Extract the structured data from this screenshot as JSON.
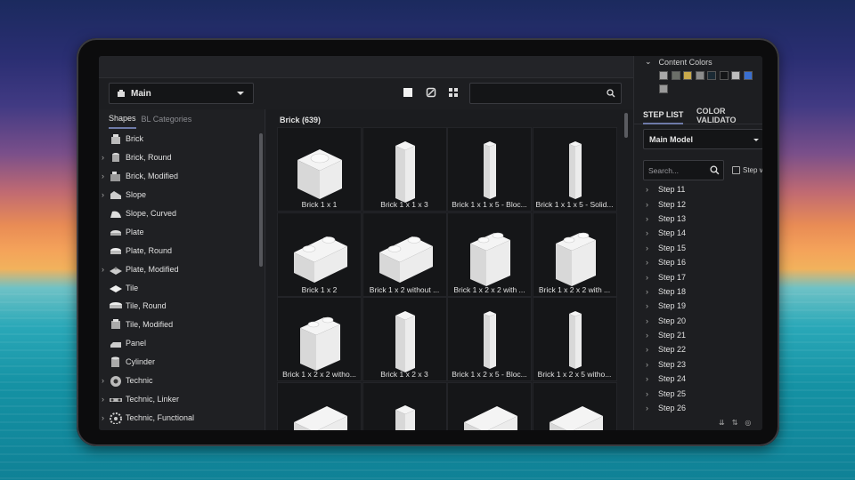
{
  "toolbar": {
    "model_dropdown": "Main",
    "search_placeholder": ""
  },
  "left_tabs": [
    {
      "label": "Shapes",
      "active": true
    },
    {
      "label": "BL Categories",
      "active": false
    }
  ],
  "categories": [
    {
      "label": "Brick",
      "expandable": false,
      "icon": "brick-icon"
    },
    {
      "label": "Brick, Round",
      "expandable": true,
      "icon": "round-brick-icon"
    },
    {
      "label": "Brick, Modified",
      "expandable": true,
      "icon": "modified-brick-icon"
    },
    {
      "label": "Slope",
      "expandable": true,
      "icon": "slope-icon"
    },
    {
      "label": "Slope, Curved",
      "expandable": false,
      "icon": "curved-slope-icon"
    },
    {
      "label": "Plate",
      "expandable": false,
      "icon": "plate-icon"
    },
    {
      "label": "Plate, Round",
      "expandable": false,
      "icon": "round-plate-icon"
    },
    {
      "label": "Plate, Modified",
      "expandable": true,
      "icon": "modified-plate-icon"
    },
    {
      "label": "Tile",
      "expandable": false,
      "icon": "tile-icon"
    },
    {
      "label": "Tile, Round",
      "expandable": false,
      "icon": "round-tile-icon"
    },
    {
      "label": "Tile, Modified",
      "expandable": false,
      "icon": "modified-tile-icon"
    },
    {
      "label": "Panel",
      "expandable": false,
      "icon": "panel-icon"
    },
    {
      "label": "Cylinder",
      "expandable": false,
      "icon": "cylinder-icon"
    },
    {
      "label": "Technic",
      "expandable": true,
      "icon": "technic-icon"
    },
    {
      "label": "Technic, Linker",
      "expandable": true,
      "icon": "technic-linker-icon"
    },
    {
      "label": "Technic, Functional",
      "expandable": true,
      "icon": "technic-functional-icon"
    }
  ],
  "grid": {
    "title": "Brick (639)",
    "parts": [
      {
        "label": "Brick 1 x 1",
        "shape": "cube"
      },
      {
        "label": "Brick 1 x 1 x 3",
        "shape": "tall"
      },
      {
        "label": "Brick 1 x 1 x 5 - Bloc...",
        "shape": "tall-thin"
      },
      {
        "label": "Brick 1 x 1 x 5 - Solid...",
        "shape": "tall-thin"
      },
      {
        "label": "Brick 1 x 2",
        "shape": "wide"
      },
      {
        "label": "Brick 1 x 2 without ...",
        "shape": "wide"
      },
      {
        "label": "Brick 1 x 2 x 2 with ...",
        "shape": "block"
      },
      {
        "label": "Brick 1 x 2 x 2 with ...",
        "shape": "block"
      },
      {
        "label": "Brick 1 x 2 x 2 witho...",
        "shape": "block"
      },
      {
        "label": "Brick 1 x 2 x 3",
        "shape": "tall"
      },
      {
        "label": "Brick 1 x 2 x 5 - Bloc...",
        "shape": "tall-thin"
      },
      {
        "label": "Brick 1 x 2 x 5 witho...",
        "shape": "tall-thin"
      },
      {
        "label": "",
        "shape": "wide-partial"
      },
      {
        "label": "",
        "shape": "tall-partial"
      },
      {
        "label": "",
        "shape": "wide-partial"
      },
      {
        "label": "",
        "shape": "wide-partial"
      }
    ]
  },
  "content_colors": {
    "title": "Content Colors",
    "swatches": [
      "#a8a8a8",
      "#6b6e68",
      "#c9a94b",
      "#8c8c8c",
      "#1b2a34",
      "#141517",
      "#bdbdbd",
      "#3a6fcf",
      "#9a9a9a"
    ]
  },
  "right_tabs": [
    {
      "label": "STEP LIST",
      "active": true
    },
    {
      "label": "COLOR VALIDATO",
      "active": false
    }
  ],
  "model_select": "Main Model",
  "step_search_placeholder": "Search...",
  "step_checkbox_label": "Step vi",
  "steps": [
    "Step 11",
    "Step 12",
    "Step 13",
    "Step 14",
    "Step 15",
    "Step 16",
    "Step 17",
    "Step 18",
    "Step 19",
    "Step 20",
    "Step 21",
    "Step 22",
    "Step 23",
    "Step 24",
    "Step 25",
    "Step 26"
  ]
}
